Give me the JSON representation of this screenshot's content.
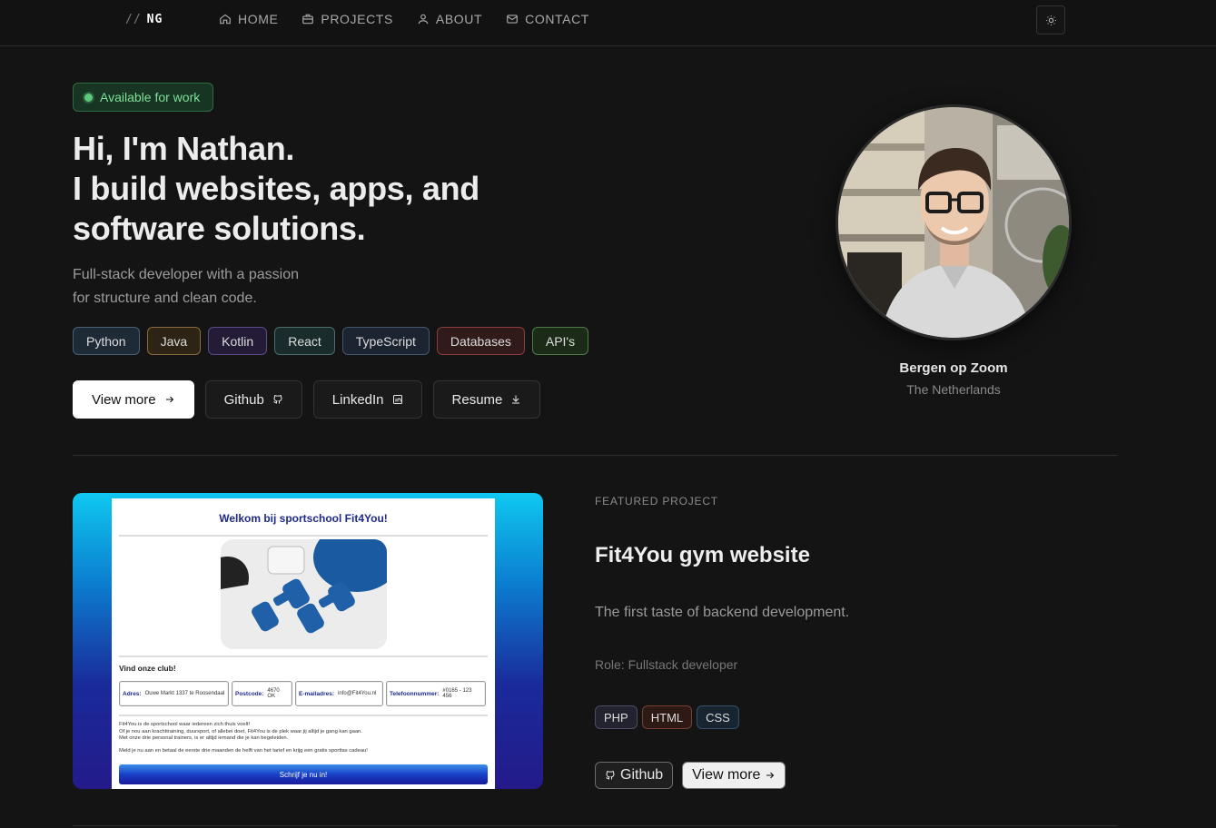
{
  "nav": {
    "logo_prefix": "//",
    "logo": "NG",
    "items": [
      {
        "label": "HOME",
        "icon": "home-icon"
      },
      {
        "label": "PROJECTS",
        "icon": "briefcase-icon"
      },
      {
        "label": "ABOUT",
        "icon": "user-icon"
      },
      {
        "label": "CONTACT",
        "icon": "mail-icon"
      }
    ],
    "theme_toggle_icon": "sun-icon"
  },
  "hero": {
    "status": "Available for work",
    "status_color": "#5cc97b",
    "headline": [
      "Hi, I'm Nathan.",
      "I build websites, apps, and",
      "software solutions."
    ],
    "subtitle": [
      "Full-stack developer with a passion",
      "for structure and clean code."
    ],
    "skills": [
      {
        "label": "Python",
        "color": "#5a7a99"
      },
      {
        "label": "Java",
        "color": "#a6793a"
      },
      {
        "label": "Kotlin",
        "color": "#7a5aa8"
      },
      {
        "label": "React",
        "color": "#4a8a8a"
      },
      {
        "label": "TypeScript",
        "color": "#4a6e9a"
      },
      {
        "label": "Databases",
        "color": "#a84a4a"
      },
      {
        "label": "API's",
        "color": "#5a8a4a"
      }
    ],
    "buttons": {
      "view_more": "View more",
      "github": "Github",
      "linkedin": "LinkedIn",
      "resume": "Resume"
    }
  },
  "profile": {
    "city": "Bergen op Zoom",
    "country": "The Netherlands"
  },
  "featured": {
    "eyebrow": "FEATURED PROJECT",
    "title": "Fit4You gym website",
    "description": "The first taste of backend development.",
    "role": "Role: Fullstack developer",
    "tags": [
      {
        "label": "PHP",
        "color": "#5a5a7a"
      },
      {
        "label": "HTML",
        "color": "#8a4a3a"
      },
      {
        "label": "CSS",
        "color": "#3a5a7a"
      }
    ],
    "buttons": {
      "github": "Github",
      "view_more": "View more"
    },
    "screenshot": {
      "title": "Welkom bij sportschool Fit4You!",
      "find_heading": "Vind onze club!",
      "info": [
        {
          "label": "Adres:",
          "value": "Ouwe Markt 1337 te Roosendaal"
        },
        {
          "label": "Postcode:",
          "value": "4670 OK"
        },
        {
          "label": "E-mailadres:",
          "value": "info@Fit4You.nl"
        },
        {
          "label": "Telefoonnummer:",
          "value": "#0165 - 123 456"
        }
      ],
      "paragraph": [
        "Fit4You is de sportschool waar iedereen zich thuis voelt!",
        "Of je nou aan krachttraining, duursport, of allebei doet, Fit4You is de plek waar jij altijd je gang kan gaan.",
        "Met onze drie personal trainers, is er altijd iemand die je kan begeleiden."
      ],
      "promo": "Meld je nu aan en betaal de eerste drie maanden de helft van het tarief en krijg een gratis sporttas cadeau!",
      "join_button": "Schrijf je nu in!"
    }
  }
}
